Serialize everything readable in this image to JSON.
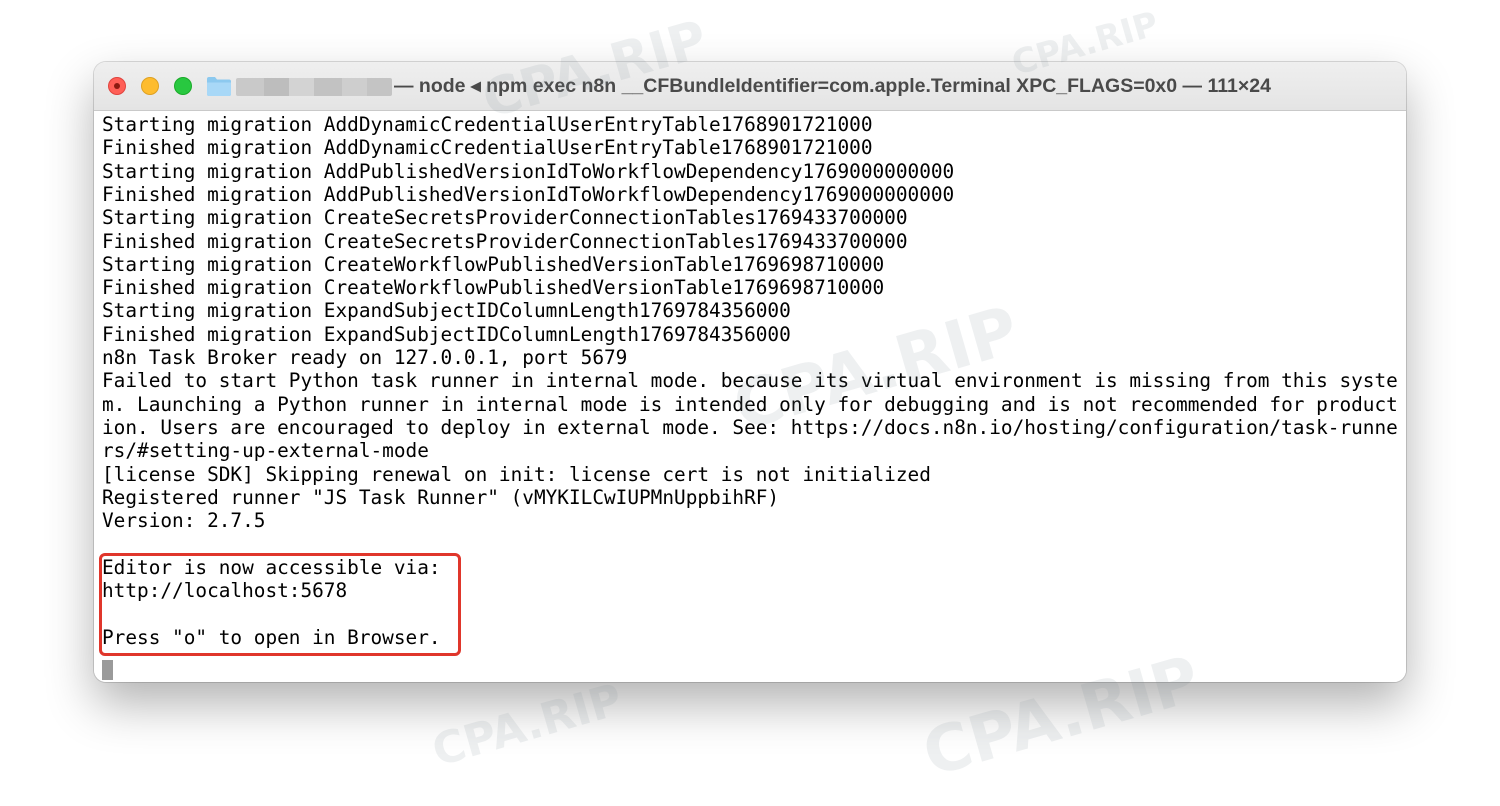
{
  "window": {
    "title": "— node ◂ npm exec n8n __CFBundleIdentifier=com.apple.Terminal XPC_FLAGS=0x0 — 111×24"
  },
  "icons": {
    "traffic_lights": [
      "close-icon",
      "minimize-icon",
      "zoom-icon"
    ],
    "folder": "folder-icon"
  },
  "terminal": {
    "lines": [
      "Starting migration AddDynamicCredentialUserEntryTable1768901721000",
      "Finished migration AddDynamicCredentialUserEntryTable1768901721000",
      "Starting migration AddPublishedVersionIdToWorkflowDependency1769000000000",
      "Finished migration AddPublishedVersionIdToWorkflowDependency1769000000000",
      "Starting migration CreateSecretsProviderConnectionTables1769433700000",
      "Finished migration CreateSecretsProviderConnectionTables1769433700000",
      "Starting migration CreateWorkflowPublishedVersionTable1769698710000",
      "Finished migration CreateWorkflowPublishedVersionTable1769698710000",
      "Starting migration ExpandSubjectIDColumnLength1769784356000",
      "Finished migration ExpandSubjectIDColumnLength1769784356000",
      "n8n Task Broker ready on 127.0.0.1, port 5679",
      "Failed to start Python task runner in internal mode. because its virtual environment is missing from this syste",
      "m. Launching a Python runner in internal mode is intended only for debugging and is not recommended for product",
      "ion. Users are encouraged to deploy in external mode. See: https://docs.n8n.io/hosting/configuration/task-runne",
      "rs/#setting-up-external-mode",
      "[license SDK] Skipping renewal on init: license cert is not initialized",
      "Registered runner \"JS Task Runner\" (vMYKILCwIUPMnUppbihRF)",
      "Version: 2.7.5",
      "",
      "Editor is now accessible via:",
      "http://localhost:5678",
      "",
      "Press \"o\" to open in Browser."
    ]
  },
  "colors": {
    "highlight": "#e0362b",
    "close": "#ff5f57",
    "minimize": "#febc2e",
    "zoom": "#28c840"
  },
  "watermark": {
    "text": "CPA.RIP"
  }
}
